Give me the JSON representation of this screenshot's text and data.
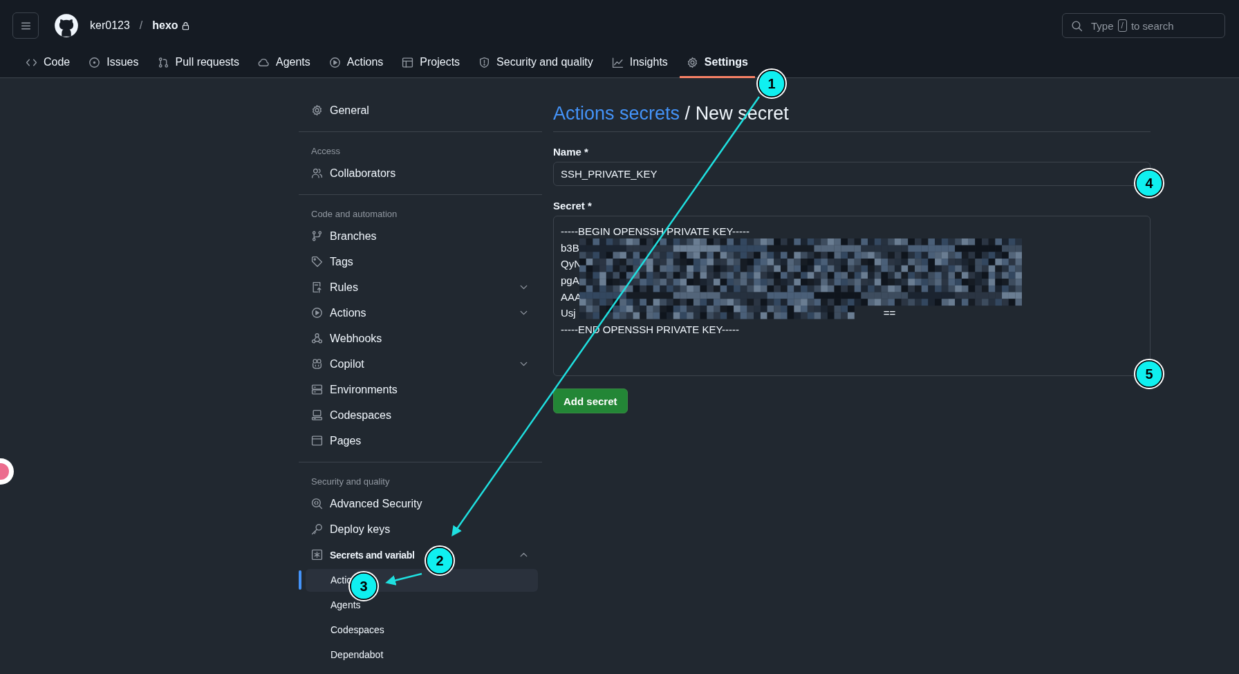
{
  "header": {
    "owner": "ker0123",
    "separator": "/",
    "repo": "hexo",
    "private": true,
    "search": {
      "before": "Type",
      "key": "/",
      "after": "to search"
    }
  },
  "tabs": [
    {
      "label": "Code",
      "selected": false
    },
    {
      "label": "Issues",
      "selected": false
    },
    {
      "label": "Pull requests",
      "selected": false
    },
    {
      "label": "Agents",
      "selected": false
    },
    {
      "label": "Actions",
      "selected": false
    },
    {
      "label": "Projects",
      "selected": false
    },
    {
      "label": "Security and quality",
      "selected": false
    },
    {
      "label": "Insights",
      "selected": false
    },
    {
      "label": "Settings",
      "selected": true
    }
  ],
  "sidebar": [
    {
      "kind": "item",
      "label": "General"
    },
    {
      "kind": "heading",
      "label": "Access"
    },
    {
      "kind": "item",
      "label": "Collaborators"
    },
    {
      "kind": "heading",
      "label": "Code and automation"
    },
    {
      "kind": "item",
      "label": "Branches"
    },
    {
      "kind": "item",
      "label": "Tags"
    },
    {
      "kind": "item",
      "label": "Rules",
      "expanded": false
    },
    {
      "kind": "item",
      "label": "Actions",
      "expanded": false
    },
    {
      "kind": "item",
      "label": "Webhooks"
    },
    {
      "kind": "item",
      "label": "Copilot",
      "expanded": false
    },
    {
      "kind": "item",
      "label": "Environments"
    },
    {
      "kind": "item",
      "label": "Codespaces"
    },
    {
      "kind": "item",
      "label": "Pages"
    },
    {
      "kind": "heading",
      "label": "Security and quality"
    },
    {
      "kind": "item",
      "label": "Advanced Security"
    },
    {
      "kind": "item",
      "label": "Deploy keys"
    },
    {
      "kind": "item",
      "label": "Secrets and variabl",
      "expanded": true,
      "children": [
        {
          "label": "Actio",
          "selected": true
        },
        {
          "label": "Agents",
          "selected": false
        },
        {
          "label": "Codespaces",
          "selected": false
        },
        {
          "label": "Dependabot",
          "selected": false
        }
      ]
    }
  ],
  "page": {
    "breadcrumb": "Actions secrets",
    "separator": "/",
    "title": "New secret"
  },
  "name_field": {
    "label": "Name *",
    "value": "SSH_PRIVATE_KEY"
  },
  "secret_field": {
    "label": "Secret *",
    "lines": [
      {
        "text": "-----BEGIN OPENSSH PRIVATE KEY-----"
      },
      {
        "text": "b3B"
      },
      {
        "text": "QyN"
      },
      {
        "text": "pgA"
      },
      {
        "text": "AAA"
      },
      {
        "text": "Usj",
        "tail": "=="
      },
      {
        "text": "-----END OPENSSH PRIVATE KEY-----"
      }
    ]
  },
  "submit_button": "Add secret",
  "annotations": [
    {
      "label": "1"
    },
    {
      "label": "2"
    },
    {
      "label": "3"
    },
    {
      "label": "4"
    },
    {
      "label": "5"
    }
  ]
}
